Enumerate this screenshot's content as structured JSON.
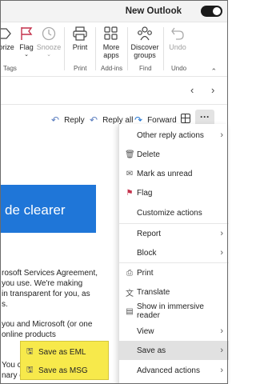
{
  "topbar": {
    "new_outlook_label": "New Outlook"
  },
  "ribbon": {
    "categorize_label": "orize",
    "flag_label": "Flag",
    "snooze_label": "Snooze",
    "tags_group": "Tags",
    "print_label": "Print",
    "print_group": "Print",
    "more_apps_line1": "More",
    "more_apps_line2": "apps",
    "addins_group": "Add-ins",
    "discover_line1": "Discover",
    "discover_line2": "groups",
    "find_group": "Find",
    "undo_label": "Undo",
    "undo_group": "Undo"
  },
  "actions": {
    "reply": "Reply",
    "reply_all": "Reply all",
    "forward": "Forward",
    "more": "···"
  },
  "email": {
    "banner_text": "de clearer",
    "lines": [
      "rosoft Services Agreement,",
      "you use. We're making",
      "in transparent for you, as",
      "s.",
      "you and Microsoft (or one",
      "online products",
      "You ca",
      "nary c"
    ]
  },
  "menu": {
    "items": [
      {
        "label": "Other reply actions",
        "icon": "none",
        "submenu": true
      },
      {
        "label": "Delete",
        "icon": "trash-icon",
        "submenu": false
      },
      {
        "label": "Mark as unread",
        "icon": "envelope-icon",
        "submenu": false
      },
      {
        "label": "Flag",
        "icon": "flag-icon",
        "submenu": false
      },
      {
        "label": "Customize actions",
        "icon": "none",
        "submenu": false
      },
      {
        "label": "Report",
        "icon": "none",
        "submenu": true
      },
      {
        "label": "Block",
        "icon": "none",
        "submenu": true
      },
      {
        "label": "Print",
        "icon": "printer-icon",
        "submenu": false
      },
      {
        "label": "Translate",
        "icon": "translate-icon",
        "submenu": false
      },
      {
        "label": "Show in immersive reader",
        "icon": "reader-icon",
        "submenu": false
      },
      {
        "label": "View",
        "icon": "none",
        "submenu": true
      },
      {
        "label": "Save as",
        "icon": "none",
        "submenu": true
      },
      {
        "label": "Advanced actions",
        "icon": "none",
        "submenu": true
      }
    ]
  },
  "submenu": {
    "items": [
      {
        "label": "Save as EML",
        "icon": "save-icon"
      },
      {
        "label": "Save as MSG",
        "icon": "save-icon"
      }
    ],
    "highlight_color": "#f7e94b"
  },
  "colors": {
    "accent": "#1f76d8",
    "flag": "#c4314b"
  }
}
